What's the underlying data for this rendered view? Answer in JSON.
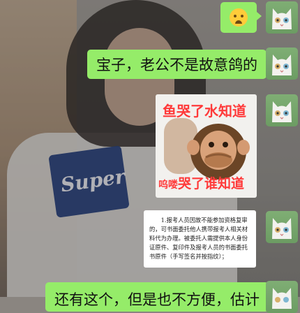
{
  "chat": {
    "messages": [
      {
        "type": "emoji",
        "emoji": "crying-face"
      },
      {
        "type": "text",
        "text": "宝子，老公不是故意鸽的"
      },
      {
        "type": "sticker",
        "top_text": "鱼哭了水知道",
        "bottom_prefix": "呜喽",
        "bottom_text": "哭了谁知道"
      },
      {
        "type": "document",
        "text": "1.报考人员因故不能参加资格复审的，可书面委托他人携带报考人相关材料代为办理。被委托人需提供本人身份证原件、复印件及报考人员的书面委托书原件（手写签名并按指纹）；"
      },
      {
        "type": "text",
        "text": "还有这个，但是也不方便，估计"
      }
    ]
  },
  "colors": {
    "bubble": "#95ec69",
    "avatar": "#7fae74",
    "sticker_text": "#ff3a3a"
  },
  "background": {
    "logo_text": "Super"
  }
}
